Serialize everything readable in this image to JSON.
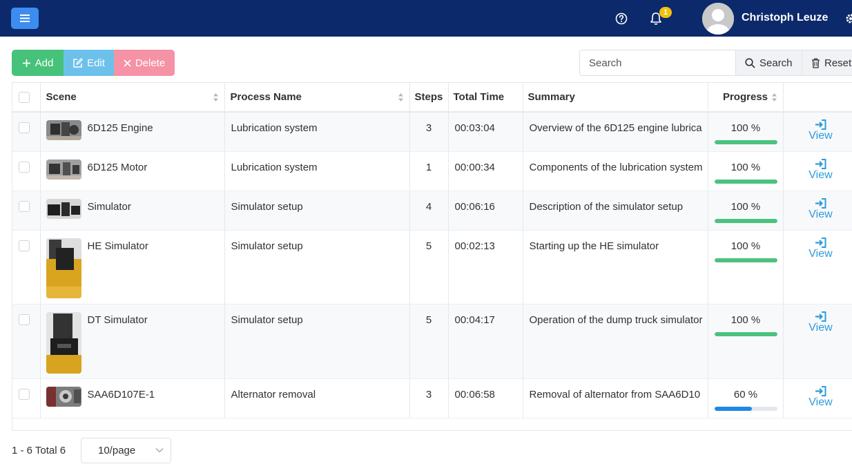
{
  "header": {
    "notification_count": "1",
    "user_name": "Christoph Leuze",
    "icons": [
      "menu-icon",
      "help-icon",
      "bell-icon",
      "avatar",
      "gear-icon"
    ]
  },
  "toolbar": {
    "add_label": "Add",
    "edit_label": "Edit",
    "delete_label": "Delete",
    "search_placeholder": "Search",
    "search_label": "Search",
    "reset_label": "Reset"
  },
  "table": {
    "columns": {
      "scene": "Scene",
      "process": "Process Name",
      "steps": "Steps",
      "time": "Total Time",
      "summary": "Summary",
      "progress": "Progress"
    },
    "view_label": "View",
    "rows": [
      {
        "scene": "6D125 Engine",
        "process": "Lubrication system",
        "steps": "3",
        "time": "00:03:04",
        "summary": "Overview of the 6D125 engine lubrica",
        "progress_label": "100 %",
        "progress": 100
      },
      {
        "scene": "6D125 Motor",
        "process": "Lubrication system",
        "steps": "1",
        "time": "00:00:34",
        "summary": "Components of the lubrication system",
        "progress_label": "100 %",
        "progress": 100
      },
      {
        "scene": "Simulator",
        "process": "Simulator setup",
        "steps": "4",
        "time": "00:06:16",
        "summary": "Description of the simulator setup",
        "progress_label": "100 %",
        "progress": 100
      },
      {
        "scene": "HE Simulator",
        "process": "Simulator setup",
        "steps": "5",
        "time": "00:02:13",
        "summary": "Starting up the HE simulator",
        "progress_label": "100 %",
        "progress": 100
      },
      {
        "scene": "DT Simulator",
        "process": "Simulator setup",
        "steps": "5",
        "time": "00:04:17",
        "summary": "Operation of the dump truck simulator",
        "progress_label": "100 %",
        "progress": 100
      },
      {
        "scene": "SAA6D107E-1",
        "process": "Alternator removal",
        "steps": "3",
        "time": "00:06:58",
        "summary": "Removal of alternator from SAA6D10",
        "progress_label": "60 %",
        "progress": 60
      }
    ]
  },
  "pagination": {
    "total_text": "1 - 6 Total 6",
    "page_size": "10/page"
  },
  "colors": {
    "header_bg": "#0c2a6b",
    "add": "#47c27a",
    "edit": "#6cc1eb",
    "delete": "#f592a6",
    "progress_complete": "#4cc27f",
    "progress_partial": "#1e88e5",
    "link": "#2d9bdc"
  }
}
